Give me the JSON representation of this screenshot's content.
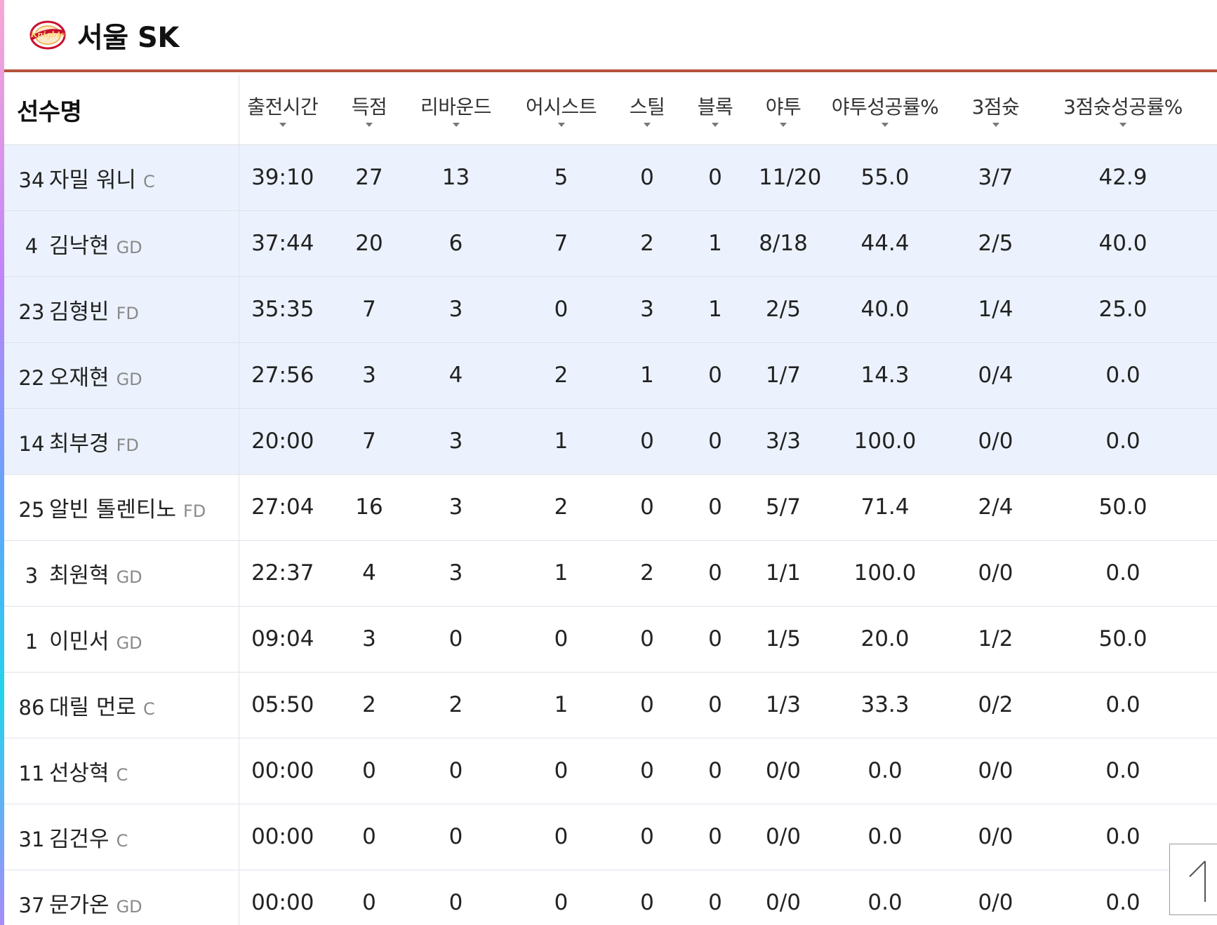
{
  "team": {
    "name": "서울 SK",
    "logo_text": "Knights",
    "logo_color": "#c8102e"
  },
  "columns": {
    "name": "선수명",
    "stats": [
      "출전시간",
      "득점",
      "리바운드",
      "어시스트",
      "스틸",
      "블록",
      "야투",
      "야투성공률%",
      "3점슛",
      "3점슛성공률%"
    ]
  },
  "players": [
    {
      "num": "34",
      "name": "자밀 워니",
      "pos": "C",
      "starter": true,
      "stats": [
        "39:10",
        "27",
        "13",
        "5",
        "0",
        "0",
        "11/20",
        "55.0",
        "3/7",
        "42.9"
      ]
    },
    {
      "num": "4",
      "name": "김낙현",
      "pos": "GD",
      "starter": true,
      "stats": [
        "37:44",
        "20",
        "6",
        "7",
        "2",
        "1",
        "8/18",
        "44.4",
        "2/5",
        "40.0"
      ]
    },
    {
      "num": "23",
      "name": "김형빈",
      "pos": "FD",
      "starter": true,
      "stats": [
        "35:35",
        "7",
        "3",
        "0",
        "3",
        "1",
        "2/5",
        "40.0",
        "1/4",
        "25.0"
      ]
    },
    {
      "num": "22",
      "name": "오재현",
      "pos": "GD",
      "starter": true,
      "stats": [
        "27:56",
        "3",
        "4",
        "2",
        "1",
        "0",
        "1/7",
        "14.3",
        "0/4",
        "0.0"
      ]
    },
    {
      "num": "14",
      "name": "최부경",
      "pos": "FD",
      "starter": true,
      "stats": [
        "20:00",
        "7",
        "3",
        "1",
        "0",
        "0",
        "3/3",
        "100.0",
        "0/0",
        "0.0"
      ]
    },
    {
      "num": "25",
      "name": "알빈 톨렌티노",
      "pos": "FD",
      "starter": false,
      "stats": [
        "27:04",
        "16",
        "3",
        "2",
        "0",
        "0",
        "5/7",
        "71.4",
        "2/4",
        "50.0"
      ]
    },
    {
      "num": "3",
      "name": "최원혁",
      "pos": "GD",
      "starter": false,
      "stats": [
        "22:37",
        "4",
        "3",
        "1",
        "2",
        "0",
        "1/1",
        "100.0",
        "0/0",
        "0.0"
      ]
    },
    {
      "num": "1",
      "name": "이민서",
      "pos": "GD",
      "starter": false,
      "stats": [
        "09:04",
        "3",
        "0",
        "0",
        "0",
        "0",
        "1/5",
        "20.0",
        "1/2",
        "50.0"
      ]
    },
    {
      "num": "86",
      "name": "대릴 먼로",
      "pos": "C",
      "starter": false,
      "stats": [
        "05:50",
        "2",
        "2",
        "1",
        "0",
        "0",
        "1/3",
        "33.3",
        "0/2",
        "0.0"
      ]
    },
    {
      "num": "11",
      "name": "선상혁",
      "pos": "C",
      "starter": false,
      "stats": [
        "00:00",
        "0",
        "0",
        "0",
        "0",
        "0",
        "0/0",
        "0.0",
        "0/0",
        "0.0"
      ]
    },
    {
      "num": "31",
      "name": "김건우",
      "pos": "C",
      "starter": false,
      "stats": [
        "00:00",
        "0",
        "0",
        "0",
        "0",
        "0",
        "0/0",
        "0.0",
        "0/0",
        "0.0"
      ]
    },
    {
      "num": "37",
      "name": "문가온",
      "pos": "GD",
      "starter": false,
      "stats": [
        "00:00",
        "0",
        "0",
        "0",
        "0",
        "0",
        "0/0",
        "0.0",
        "0/0",
        "0.0"
      ]
    }
  ],
  "colors": {
    "header_rule": "#b5533c",
    "starter_row_bg": "#ebf2fd"
  },
  "icons": {
    "sort": "sort-down-icon",
    "scroll_top": "arrow-up-icon"
  }
}
